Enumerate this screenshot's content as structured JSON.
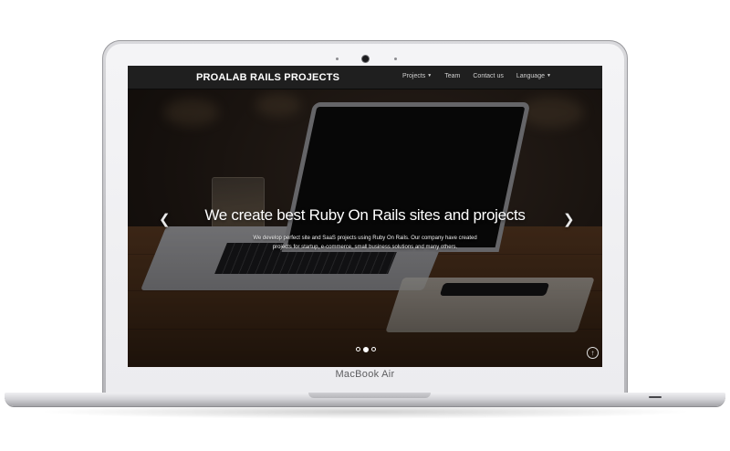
{
  "device": {
    "brand_label": "MacBook Air"
  },
  "navbar": {
    "brand": "PROALAB RAILS PROJECTS",
    "links": [
      {
        "label": "Projects",
        "dropdown": true
      },
      {
        "label": "Team",
        "dropdown": false
      },
      {
        "label": "Contact us",
        "dropdown": false
      },
      {
        "label": "Language",
        "dropdown": true
      }
    ]
  },
  "hero": {
    "title": "We create best Ruby On Rails sites and projects",
    "text": "We develop perfect site and SaaS projects using Ruby On Rails. Our company have created projects for startup, e-commerce, small business solutions and many others.",
    "prev_icon": "chevron-left-icon",
    "next_icon": "chevron-right-icon",
    "slides_count": 3,
    "active_slide": 2
  },
  "scroll_top": {
    "icon": "arrow-up-circle-icon"
  }
}
